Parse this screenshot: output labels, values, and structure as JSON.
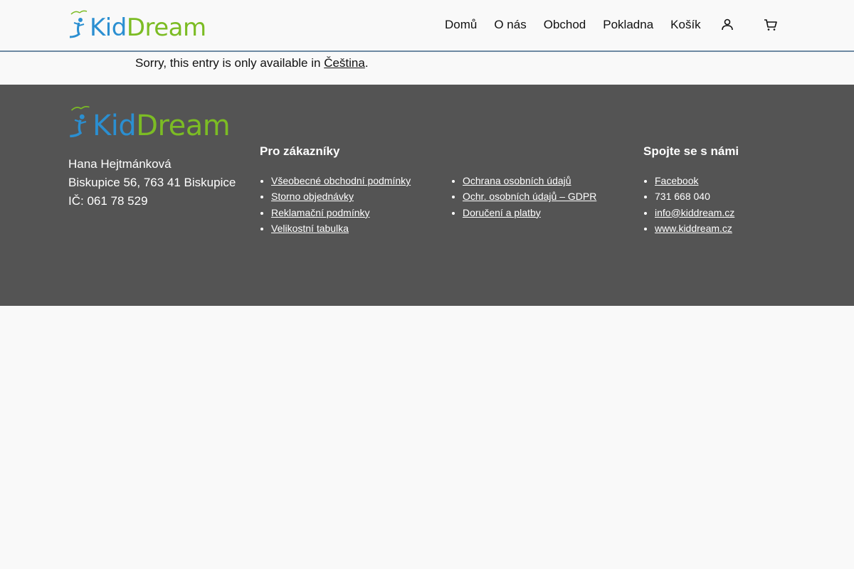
{
  "brand": {
    "kid": "Kid",
    "dream": "Dream"
  },
  "nav": [
    {
      "label": "Domů"
    },
    {
      "label": "O nás"
    },
    {
      "label": "Obchod"
    },
    {
      "label": "Pokladna"
    },
    {
      "label": "Košík"
    }
  ],
  "icons": {
    "account": "user-icon",
    "cart": "cart-icon"
  },
  "notice": {
    "text": "Sorry, this entry is only available in ",
    "link": "Čeština",
    "suffix": "."
  },
  "footer": {
    "address": {
      "name": "Hana Hejtmánková",
      "street": "Biskupice 56,  763 41 Biskupice",
      "ico": "IČ: 061 78 529"
    },
    "customers": {
      "title": "Pro zákazníky",
      "links_left": [
        "Všeobecné obchodní podmínky",
        "Storno objednávky",
        "Reklamační podmínky",
        "Velikostní tabulka"
      ],
      "links_right": [
        "Ochrana osobních údajů",
        "Ochr. osobních údajů – GDPR",
        "Doručení a platby"
      ]
    },
    "contact": {
      "title": "Spojte se s námi",
      "facebook": "Facebook",
      "phone": "731 668 040",
      "email": "info@kiddream.cz",
      "web": "www.kiddream.cz"
    }
  },
  "colors": {
    "kid_blue": "#2b8fd1",
    "dream_green": "#7cbc24",
    "footer_bg": "#545454"
  }
}
